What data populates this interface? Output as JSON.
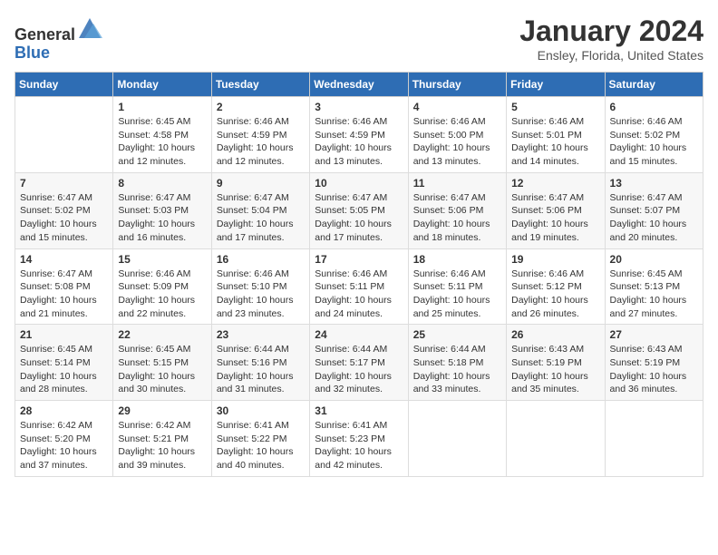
{
  "header": {
    "logo_general": "General",
    "logo_blue": "Blue",
    "month_title": "January 2024",
    "location": "Ensley, Florida, United States"
  },
  "weekdays": [
    "Sunday",
    "Monday",
    "Tuesday",
    "Wednesday",
    "Thursday",
    "Friday",
    "Saturday"
  ],
  "weeks": [
    [
      {
        "day": "",
        "info": ""
      },
      {
        "day": "1",
        "info": "Sunrise: 6:45 AM\nSunset: 4:58 PM\nDaylight: 10 hours\nand 12 minutes."
      },
      {
        "day": "2",
        "info": "Sunrise: 6:46 AM\nSunset: 4:59 PM\nDaylight: 10 hours\nand 12 minutes."
      },
      {
        "day": "3",
        "info": "Sunrise: 6:46 AM\nSunset: 4:59 PM\nDaylight: 10 hours\nand 13 minutes."
      },
      {
        "day": "4",
        "info": "Sunrise: 6:46 AM\nSunset: 5:00 PM\nDaylight: 10 hours\nand 13 minutes."
      },
      {
        "day": "5",
        "info": "Sunrise: 6:46 AM\nSunset: 5:01 PM\nDaylight: 10 hours\nand 14 minutes."
      },
      {
        "day": "6",
        "info": "Sunrise: 6:46 AM\nSunset: 5:02 PM\nDaylight: 10 hours\nand 15 minutes."
      }
    ],
    [
      {
        "day": "7",
        "info": "Sunrise: 6:47 AM\nSunset: 5:02 PM\nDaylight: 10 hours\nand 15 minutes."
      },
      {
        "day": "8",
        "info": "Sunrise: 6:47 AM\nSunset: 5:03 PM\nDaylight: 10 hours\nand 16 minutes."
      },
      {
        "day": "9",
        "info": "Sunrise: 6:47 AM\nSunset: 5:04 PM\nDaylight: 10 hours\nand 17 minutes."
      },
      {
        "day": "10",
        "info": "Sunrise: 6:47 AM\nSunset: 5:05 PM\nDaylight: 10 hours\nand 17 minutes."
      },
      {
        "day": "11",
        "info": "Sunrise: 6:47 AM\nSunset: 5:06 PM\nDaylight: 10 hours\nand 18 minutes."
      },
      {
        "day": "12",
        "info": "Sunrise: 6:47 AM\nSunset: 5:06 PM\nDaylight: 10 hours\nand 19 minutes."
      },
      {
        "day": "13",
        "info": "Sunrise: 6:47 AM\nSunset: 5:07 PM\nDaylight: 10 hours\nand 20 minutes."
      }
    ],
    [
      {
        "day": "14",
        "info": "Sunrise: 6:47 AM\nSunset: 5:08 PM\nDaylight: 10 hours\nand 21 minutes."
      },
      {
        "day": "15",
        "info": "Sunrise: 6:46 AM\nSunset: 5:09 PM\nDaylight: 10 hours\nand 22 minutes."
      },
      {
        "day": "16",
        "info": "Sunrise: 6:46 AM\nSunset: 5:10 PM\nDaylight: 10 hours\nand 23 minutes."
      },
      {
        "day": "17",
        "info": "Sunrise: 6:46 AM\nSunset: 5:11 PM\nDaylight: 10 hours\nand 24 minutes."
      },
      {
        "day": "18",
        "info": "Sunrise: 6:46 AM\nSunset: 5:11 PM\nDaylight: 10 hours\nand 25 minutes."
      },
      {
        "day": "19",
        "info": "Sunrise: 6:46 AM\nSunset: 5:12 PM\nDaylight: 10 hours\nand 26 minutes."
      },
      {
        "day": "20",
        "info": "Sunrise: 6:45 AM\nSunset: 5:13 PM\nDaylight: 10 hours\nand 27 minutes."
      }
    ],
    [
      {
        "day": "21",
        "info": "Sunrise: 6:45 AM\nSunset: 5:14 PM\nDaylight: 10 hours\nand 28 minutes."
      },
      {
        "day": "22",
        "info": "Sunrise: 6:45 AM\nSunset: 5:15 PM\nDaylight: 10 hours\nand 30 minutes."
      },
      {
        "day": "23",
        "info": "Sunrise: 6:44 AM\nSunset: 5:16 PM\nDaylight: 10 hours\nand 31 minutes."
      },
      {
        "day": "24",
        "info": "Sunrise: 6:44 AM\nSunset: 5:17 PM\nDaylight: 10 hours\nand 32 minutes."
      },
      {
        "day": "25",
        "info": "Sunrise: 6:44 AM\nSunset: 5:18 PM\nDaylight: 10 hours\nand 33 minutes."
      },
      {
        "day": "26",
        "info": "Sunrise: 6:43 AM\nSunset: 5:19 PM\nDaylight: 10 hours\nand 35 minutes."
      },
      {
        "day": "27",
        "info": "Sunrise: 6:43 AM\nSunset: 5:19 PM\nDaylight: 10 hours\nand 36 minutes."
      }
    ],
    [
      {
        "day": "28",
        "info": "Sunrise: 6:42 AM\nSunset: 5:20 PM\nDaylight: 10 hours\nand 37 minutes."
      },
      {
        "day": "29",
        "info": "Sunrise: 6:42 AM\nSunset: 5:21 PM\nDaylight: 10 hours\nand 39 minutes."
      },
      {
        "day": "30",
        "info": "Sunrise: 6:41 AM\nSunset: 5:22 PM\nDaylight: 10 hours\nand 40 minutes."
      },
      {
        "day": "31",
        "info": "Sunrise: 6:41 AM\nSunset: 5:23 PM\nDaylight: 10 hours\nand 42 minutes."
      },
      {
        "day": "",
        "info": ""
      },
      {
        "day": "",
        "info": ""
      },
      {
        "day": "",
        "info": ""
      }
    ]
  ]
}
